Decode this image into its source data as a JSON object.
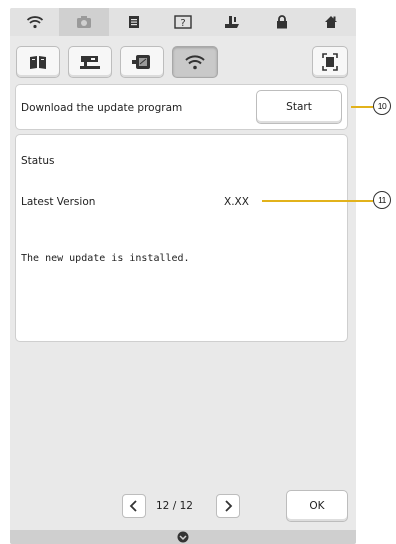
{
  "top_tabs": [
    {
      "icon": "wifi-icon",
      "active": false
    },
    {
      "icon": "camera-icon",
      "active": true
    },
    {
      "icon": "document-icon",
      "active": false
    },
    {
      "icon": "help-icon",
      "active": false
    },
    {
      "icon": "embroidery-foot-icon",
      "active": false
    },
    {
      "icon": "lock-icon",
      "active": false
    },
    {
      "icon": "home-icon",
      "active": false
    }
  ],
  "sub_tabs": [
    {
      "icon": "book-icon",
      "active": false
    },
    {
      "icon": "sewing-machine-icon",
      "active": false
    },
    {
      "icon": "embroidery-frame-icon",
      "active": false
    },
    {
      "icon": "wifi-icon",
      "active": true
    }
  ],
  "update": {
    "label": "Download the update program",
    "start_label": "Start"
  },
  "status": {
    "title": "Status",
    "latest_version_label": "Latest Version",
    "latest_version_value": "X.XX",
    "message": "The new update is installed."
  },
  "pager": {
    "text": "12 / 12"
  },
  "ok_label": "OK",
  "callouts": {
    "c10": "10",
    "c11": "11"
  },
  "colors": {
    "callout_line": "#e2b21b",
    "screen_bg": "#e9e9e9"
  }
}
